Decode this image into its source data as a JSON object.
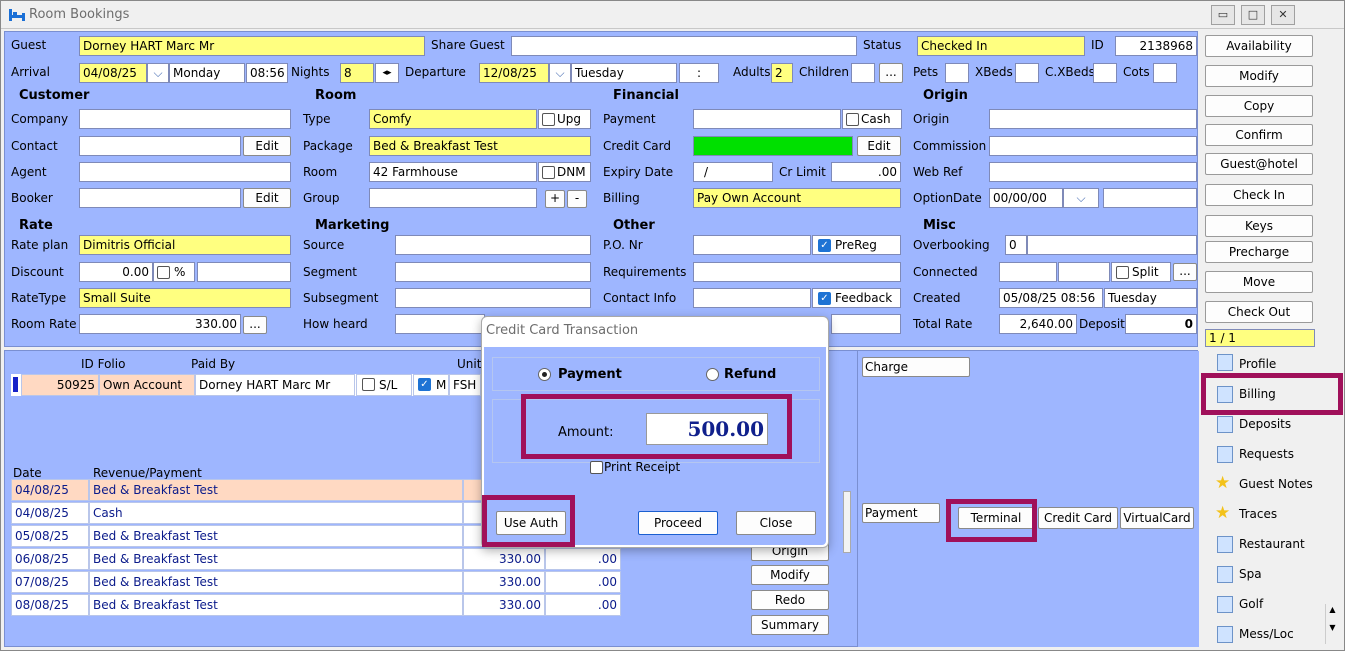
{
  "window": {
    "title": "Room Bookings",
    "min": "▭",
    "max": "□",
    "close": "✕"
  },
  "top": {
    "guest_label": "Guest",
    "guest": "Dorney HART Marc Mr",
    "share_label": "Share Guest",
    "share": "",
    "status_label": "Status",
    "status": "Checked In",
    "id_label": "ID",
    "id": "2138968",
    "arrival_label": "Arrival",
    "arrival": "04/08/25",
    "arrival_day": "Monday",
    "arrival_time": "08:56",
    "nights_label": "Nights",
    "nights": "8",
    "departure_label": "Departure",
    "departure": "12/08/25",
    "departure_day": "Tuesday",
    "departure_time": ":",
    "adults_label": "Adults",
    "adults": "2",
    "children_label": "Children",
    "children": "",
    "ellipsis": "...",
    "pets_label": "Pets",
    "xbeds_label": "XBeds",
    "cxbeds_label": "C.XBeds",
    "cots_label": "Cots"
  },
  "customer": {
    "header": "Customer",
    "company_label": "Company",
    "contact_label": "Contact",
    "agent_label": "Agent",
    "booker_label": "Booker",
    "edit": "Edit"
  },
  "room": {
    "header": "Room",
    "type_label": "Type",
    "type": "Comfy",
    "upg": "Upg",
    "package_label": "Package",
    "package": "Bed & Breakfast Test",
    "room_label": "Room",
    "room": "42 Farmhouse",
    "dnm": "DNM",
    "group_label": "Group",
    "plus": "+",
    "minus": "-"
  },
  "financial": {
    "header": "Financial",
    "payment_label": "Payment",
    "cash": "Cash",
    "cc_label": "Credit Card",
    "edit": "Edit",
    "expiry_label": "Expiry Date",
    "expiry": "/",
    "crlimit_label": "Cr Limit",
    "crlimit": ".00",
    "billing_label": "Billing",
    "billing": "Pay Own Account"
  },
  "origin": {
    "header": "Origin",
    "origin_label": "Origin",
    "commission_label": "Commission",
    "webref_label": "Web Ref",
    "optiondate_label": "OptionDate",
    "optiondate": "00/00/00"
  },
  "rate": {
    "header": "Rate",
    "plan_label": "Rate plan",
    "plan": "Dimitris Official",
    "discount_label": "Discount",
    "discount": "0.00",
    "pct": "%",
    "ratetype_label": "RateType",
    "ratetype": "Small Suite",
    "roomrate_label": "Room Rate",
    "roomrate": "330.00",
    "dots": "..."
  },
  "marketing": {
    "header": "Marketing",
    "source_label": "Source",
    "segment_label": "Segment",
    "subsegment_label": "Subsegment",
    "howheard_label": "How heard"
  },
  "other": {
    "header": "Other",
    "po_label": "P.O. Nr",
    "prereg": "PreReg",
    "requirements_label": "Requirements",
    "contact_label": "Contact Info",
    "feedback": "Feedback"
  },
  "misc": {
    "header": "Misc",
    "overbooking_label": "Overbooking",
    "overbooking": "0",
    "connected_label": "Connected",
    "split": "Split",
    "dots": "...",
    "created_label": "Created",
    "created": "05/08/25 08:56",
    "created_day": "Tuesday",
    "totalrate_label": "Total Rate",
    "totalrate": "2,640.00",
    "deposit_label": "Deposit",
    "deposit": "0"
  },
  "actions": [
    "Availability",
    "Modify",
    "Copy",
    "Confirm",
    "Guest@hotel",
    "Check In",
    "Keys",
    "Precharge",
    "Move",
    "Check Out"
  ],
  "page_indicator": "1 / 1",
  "folio": {
    "col_id": "ID Folio",
    "col_paidby": "Paid By",
    "col_unit": "Unit",
    "id": "50925",
    "account": "Own Account",
    "paidby": "Dorney HART Marc Mr",
    "sl": "S/L",
    "m": "M",
    "unit": "FSH"
  },
  "ledger": {
    "col_date": "Date",
    "col_rev": "Revenue/Payment",
    "rows": [
      {
        "date": "04/08/25",
        "desc": "Bed & Breakfast Test",
        "amt": "",
        "bal": ""
      },
      {
        "date": "04/08/25",
        "desc": "Cash",
        "amt": "",
        "bal": ""
      },
      {
        "date": "05/08/25",
        "desc": "Bed & Breakfast Test",
        "amt": "",
        "bal": ""
      },
      {
        "date": "06/08/25",
        "desc": "Bed & Breakfast Test",
        "amt": "330.00",
        "bal": ".00"
      },
      {
        "date": "07/08/25",
        "desc": "Bed & Breakfast Test",
        "amt": "330.00",
        "bal": ".00"
      },
      {
        "date": "08/08/25",
        "desc": "Bed & Breakfast Test",
        "amt": "330.00",
        "bal": ".00"
      }
    ]
  },
  "ledger_buttons": [
    "Origin",
    "Modify",
    "Redo",
    "Summary"
  ],
  "charge": {
    "charge_btn": "Charge",
    "payment_btn": "Payment",
    "terminal": "Terminal",
    "creditcard": "Credit Card",
    "virtualcard": "VirtualCard"
  },
  "tabs": [
    "Profile",
    "Billing",
    "Deposits",
    "Requests",
    "Guest Notes",
    "Traces",
    "Restaurant",
    "Spa",
    "Golf",
    "Mess/Loc"
  ],
  "dialog": {
    "title": "Credit Card Transaction",
    "payment": "Payment",
    "refund": "Refund",
    "amount_label": "Amount:",
    "amount": "500.00",
    "print_receipt": "Print Receipt",
    "use_auth": "Use Auth",
    "proceed": "Proceed",
    "close": "Close"
  },
  "colors": {
    "panel": "#9eb6ff",
    "yellow": "#ffff80",
    "highlight": "#a0105a",
    "green": "#00e000"
  }
}
